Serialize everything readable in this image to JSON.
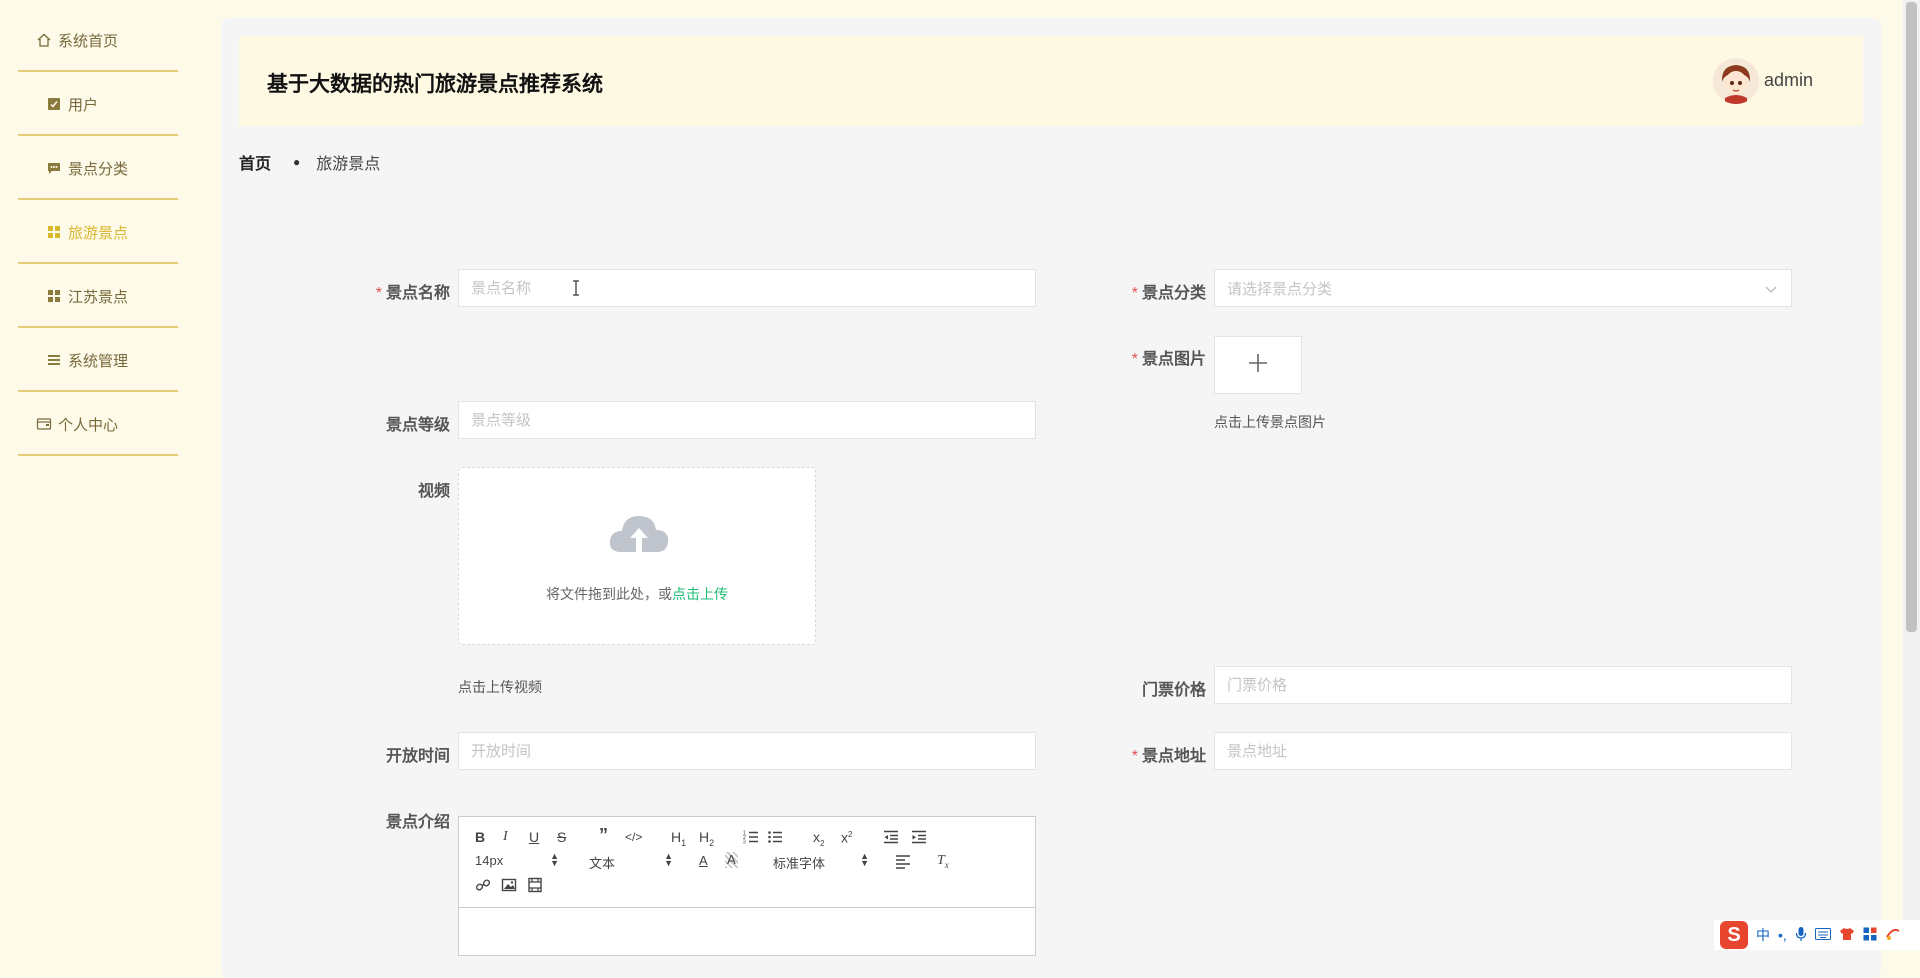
{
  "sidebar": {
    "items": [
      {
        "label": "系统首页",
        "icon": "home-icon"
      },
      {
        "label": "用户",
        "icon": "checkbox-icon"
      },
      {
        "label": "景点分类",
        "icon": "chat-icon"
      },
      {
        "label": "旅游景点",
        "icon": "grid-icon",
        "active": true
      },
      {
        "label": "江苏景点",
        "icon": "grid-icon"
      },
      {
        "label": "系统管理",
        "icon": "list-icon"
      },
      {
        "label": "个人中心",
        "icon": "wallet-icon"
      }
    ]
  },
  "header": {
    "title": "基于大数据的热门旅游景点推荐系统",
    "user": "admin"
  },
  "breadcrumb": {
    "home": "首页",
    "current": "旅游景点"
  },
  "form": {
    "name": {
      "label": "景点名称",
      "placeholder": "景点名称",
      "required": true
    },
    "category": {
      "label": "景点分类",
      "placeholder": "请选择景点分类",
      "required": true
    },
    "image": {
      "label": "景点图片",
      "hint": "点击上传景点图片",
      "required": true
    },
    "level": {
      "label": "景点等级",
      "placeholder": "景点等级"
    },
    "video": {
      "label": "视频",
      "drop_text": "将文件拖到此处，或",
      "drop_link": "点击上传",
      "hint": "点击上传视频"
    },
    "price": {
      "label": "门票价格",
      "placeholder": "门票价格"
    },
    "open_time": {
      "label": "开放时间",
      "placeholder": "开放时间"
    },
    "address": {
      "label": "景点地址",
      "placeholder": "景点地址",
      "required": true
    },
    "intro": {
      "label": "景点介绍"
    }
  },
  "editor": {
    "font_size": "14px",
    "format": "文本",
    "font_family": "标准字体"
  },
  "colors": {
    "page_bg": "#fdfae9",
    "sidebar_text": "#77693a",
    "sidebar_active": "#d9b72d",
    "divider": "#e3cc73",
    "header_bg": "#fdf9e3",
    "required": "#e05252",
    "link": "#1dbf73"
  }
}
